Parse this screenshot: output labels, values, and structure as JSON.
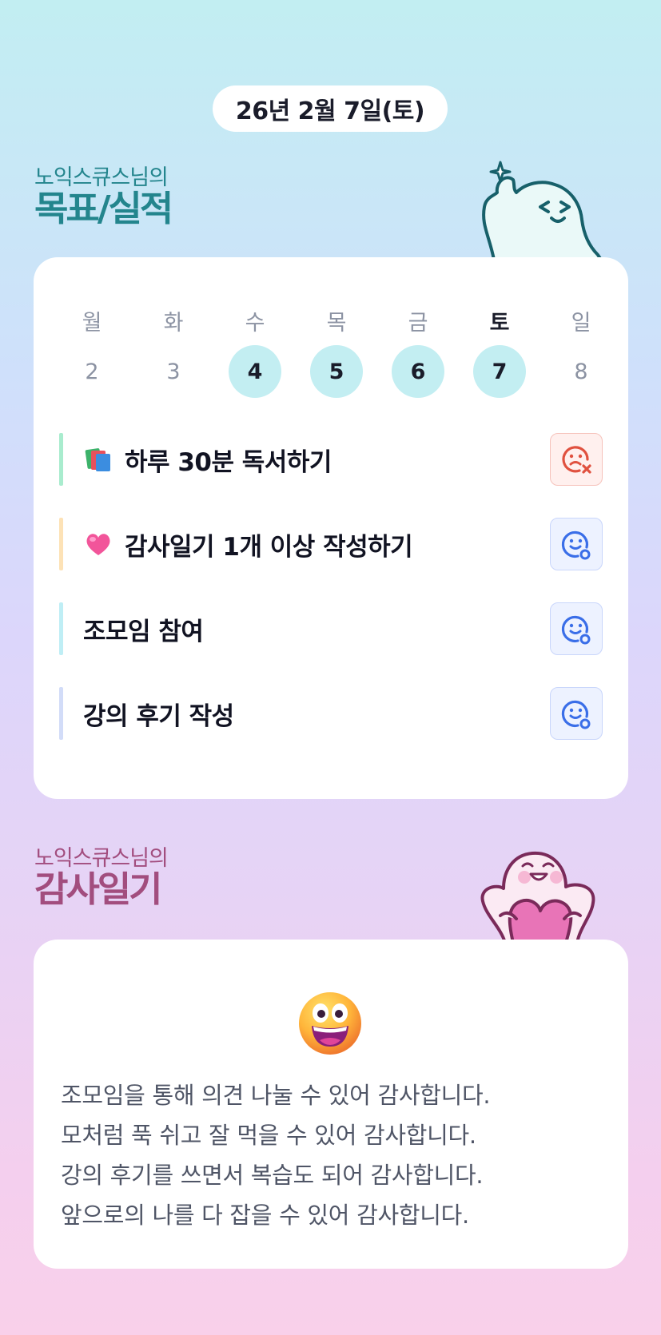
{
  "header": {
    "date": "26년 2월 7일(토)"
  },
  "goals_section": {
    "subtitle": "노익스큐스님의",
    "title": "목표/실적",
    "week": [
      {
        "day": "월",
        "date": "2",
        "done": false,
        "today": false
      },
      {
        "day": "화",
        "date": "3",
        "done": false,
        "today": false
      },
      {
        "day": "수",
        "date": "4",
        "done": true,
        "today": false
      },
      {
        "day": "목",
        "date": "5",
        "done": true,
        "today": false
      },
      {
        "day": "금",
        "date": "6",
        "done": true,
        "today": false
      },
      {
        "day": "토",
        "date": "7",
        "done": true,
        "today": true
      },
      {
        "day": "일",
        "date": "8",
        "done": false,
        "today": false
      }
    ],
    "goals": [
      {
        "label": "하루 30분 독서하기",
        "icon": "books-icon",
        "bar_color": "#a9ecce",
        "status": "fail",
        "status_icon": "sad-face-x-icon"
      },
      {
        "label": "감사일기 1개 이상 작성하기",
        "icon": "heart-icon",
        "bar_color": "#fde2b6",
        "status": "ok",
        "status_icon": "smile-face-check-icon"
      },
      {
        "label": "조모임 참여",
        "icon": "",
        "bar_color": "#bfeef5",
        "status": "ok",
        "status_icon": "smile-face-check-icon"
      },
      {
        "label": "강의 후기 작성",
        "icon": "",
        "bar_color": "#d2dcf8",
        "status": "ok",
        "status_icon": "smile-face-check-icon"
      }
    ]
  },
  "diary_section": {
    "subtitle": "노익스큐스님의",
    "title": "감사일기",
    "mood_icon": "grinning-face-icon",
    "lines": [
      "조모임을 통해 의견 나눌 수 있어 감사합니다.",
      "모처럼 푹 쉬고 잘 먹을 수 있어 감사합니다.",
      "강의 후기를 쓰면서 복습도 되어 감사합니다.",
      "앞으로의 나를 다 잡을 수 있어 감사합니다."
    ]
  },
  "colors": {
    "teal_title": "#23858d",
    "pink_title": "#a24d7e",
    "done_circle": "#c3eef2",
    "fail": "#e0513f",
    "ok": "#3a6ee8"
  }
}
